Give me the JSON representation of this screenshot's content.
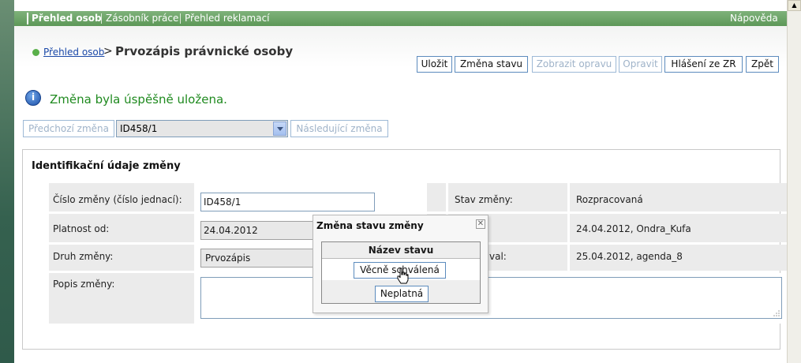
{
  "nav": {
    "items": [
      "Přehled osob",
      "Zásobník práce",
      "Přehled reklamací"
    ],
    "help": "Nápověda"
  },
  "breadcrumb": {
    "link": "Přehled osob",
    "separator": ">",
    "title": "Prvozápis právnické osoby"
  },
  "toolbar": {
    "save": "Uložit",
    "change_state": "Změna stavu",
    "show_fix": "Zobrazit opravu",
    "fix": "Opravit",
    "report_zr": "Hlášení ze ZR",
    "back": "Zpět"
  },
  "message": {
    "icon": "info-icon",
    "text": "Změna byla úspěšně uložena."
  },
  "change_nav": {
    "prev": "Předchozí změna",
    "selected": "ID458/1",
    "next": "Následující změna"
  },
  "section": {
    "title": "Identifikační údaje změny",
    "fields": {
      "number_label": "Číslo změny (číslo jednací):",
      "number_value": "ID458/1",
      "valid_from_label": "Platnost od:",
      "valid_from_value": "24.04.2012",
      "type_label": "Druh změny:",
      "type_value": "Prvozápis",
      "desc_label": "Popis změny:",
      "desc_value": "",
      "state_label": "Stav změny:",
      "state_value": "Rozpracovaná",
      "created_label_partial": "",
      "created_value": "24.04.2012, Ondra_Kufa",
      "modified_label_partial": "val:",
      "modified_value": "25.04.2012, agenda_8"
    }
  },
  "modal": {
    "title": "Změna stavu změny",
    "close": "✕",
    "column": "Název stavu",
    "options": [
      "Věcně schválená",
      "Neplatná"
    ]
  },
  "colors": {
    "nav_green": "#5d9858",
    "button_border": "#5c8bbd",
    "success_text": "#1f8a1f",
    "link": "#1b49a8"
  }
}
